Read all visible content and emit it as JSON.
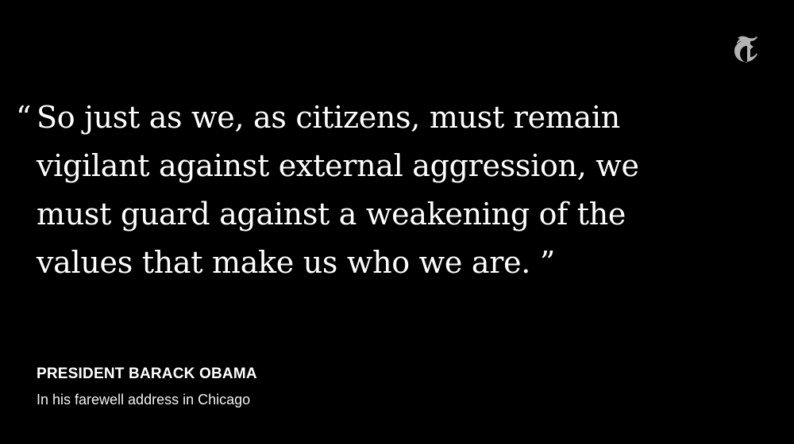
{
  "brand": {
    "logo_icon": "nyt-t-logo-icon",
    "background_color": "#000000",
    "text_color": "#ffffff"
  },
  "quote": {
    "open_mark": "“",
    "lines": [
      "So just as we, as citizens, must remain",
      "vigilant against external aggression, we",
      "must guard against a weakening of the",
      "values that make us who we are. ”"
    ]
  },
  "attribution": {
    "speaker": "PRESIDENT BARACK OBAMA",
    "context": "In his farewell address in Chicago"
  }
}
